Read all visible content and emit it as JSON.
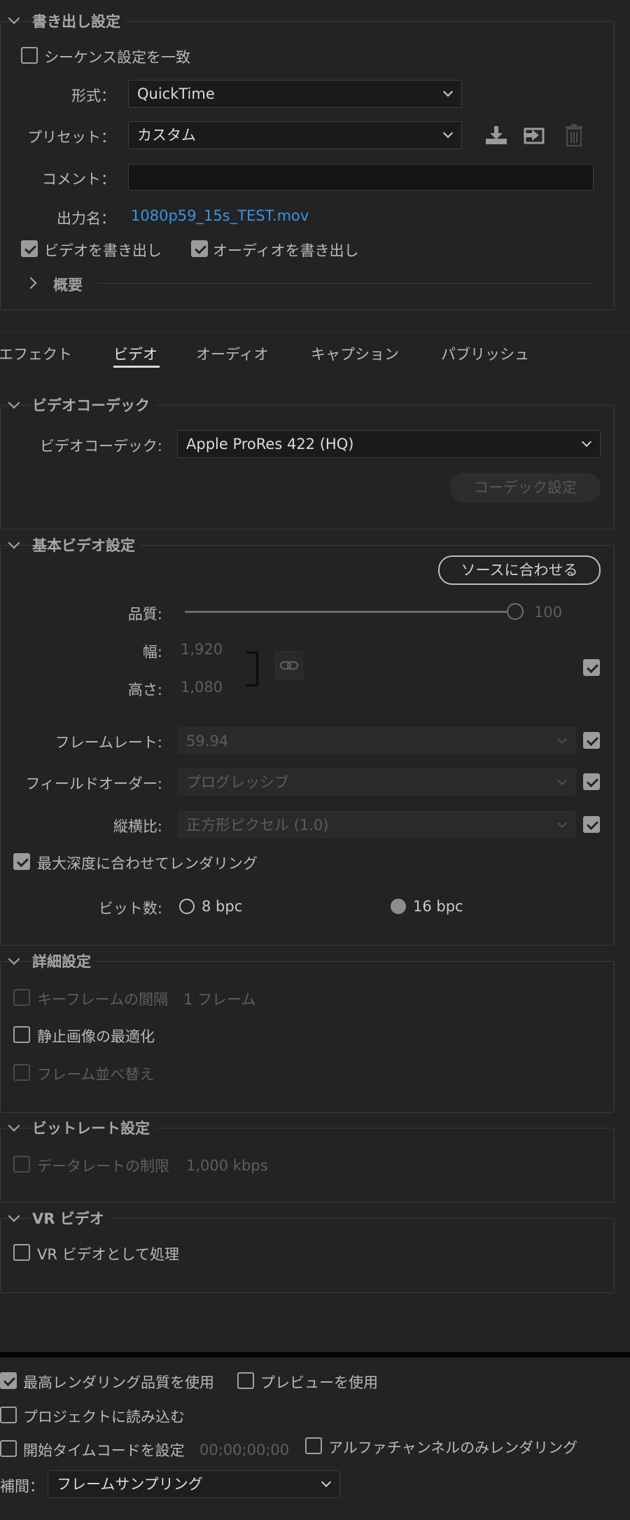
{
  "export_settings": {
    "title": "書き出し設定",
    "match_sequence": {
      "label": "シーケンス設定を一致",
      "checked": false
    },
    "format": {
      "label": "形式：",
      "value": "QuickTime"
    },
    "preset": {
      "label": "プリセット：",
      "value": "カスタム"
    },
    "comment": {
      "label": "コメント：",
      "value": ""
    },
    "output_name": {
      "label": "出力名：",
      "value": "1080p59_15s_TEST.mov"
    },
    "export_video": {
      "label": "ビデオを書き出し",
      "checked": true
    },
    "export_audio": {
      "label": "オーディオを書き出し",
      "checked": true
    },
    "summary": {
      "label": "概要"
    }
  },
  "tabs": [
    {
      "label": "エフェクト",
      "active": false
    },
    {
      "label": "ビデオ",
      "active": true
    },
    {
      "label": "オーディオ",
      "active": false
    },
    {
      "label": "キャプション",
      "active": false
    },
    {
      "label": "パブリッシュ",
      "active": false
    }
  ],
  "video_codec": {
    "title": "ビデオコーデック",
    "codec_label": "ビデオコーデック:",
    "codec_value": "Apple ProRes 422 (HQ)",
    "codec_settings_button": "コーデック設定"
  },
  "basic_video": {
    "title": "基本ビデオ設定",
    "match_source_button": "ソースに合わせる",
    "quality": {
      "label": "品質:",
      "value": "100",
      "fraction": 1.0
    },
    "width": {
      "label": "幅:",
      "value": "1,920"
    },
    "height": {
      "label": "高さ:",
      "value": "1,080"
    },
    "frame_rate": {
      "label": "フレームレート:",
      "value": "59.94"
    },
    "field_order": {
      "label": "フィールドオーダー:",
      "value": "プログレッシブ"
    },
    "aspect": {
      "label": "縦横比:",
      "value": "正方形ピクセル (1.0)"
    },
    "max_depth": {
      "label": "最大深度に合わせてレンダリング",
      "checked": true
    },
    "bit_depth": {
      "label": "ビット数:",
      "option_8": "8 bpc",
      "option_16": "16 bpc"
    }
  },
  "advanced": {
    "title": "詳細設定",
    "keyframe": {
      "label": "キーフレームの間隔",
      "value": "1 フレーム"
    },
    "optimize_stills": {
      "label": "静止画像の最適化"
    },
    "frame_reorder": {
      "label": "フレーム並べ替え"
    }
  },
  "bitrate": {
    "title": "ビットレート設定",
    "limit": {
      "label": "データレートの制限",
      "value": "1,000 kbps"
    }
  },
  "vr": {
    "title": "VR ビデオ",
    "process": {
      "label": "VR ビデオとして処理"
    }
  },
  "bottom": {
    "max_quality": {
      "label": "最高レンダリング品質を使用",
      "checked": true
    },
    "use_preview": {
      "label": "プレビューを使用",
      "checked": false
    },
    "import_project": {
      "label": "プロジェクトに読み込む",
      "checked": false
    },
    "start_timecode": {
      "label": "開始タイムコードを設定",
      "value": "00;00;00;00"
    },
    "alpha_only": {
      "label": "アルファチャンネルのみレンダリング",
      "checked": false
    },
    "interpolation": {
      "label": "補間：",
      "value": "フレームサンプリング"
    }
  },
  "colors": {
    "accent_link": "#3a93e4",
    "background": "#232323"
  }
}
